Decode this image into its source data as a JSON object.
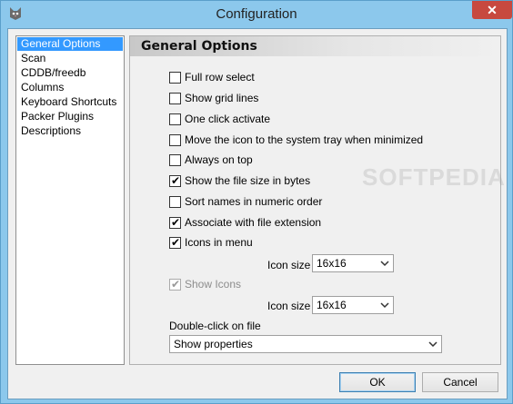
{
  "window": {
    "title": "Configuration",
    "close_glyph": "✕"
  },
  "nav": {
    "items": [
      {
        "label": "General Options",
        "selected": true
      },
      {
        "label": "Scan"
      },
      {
        "label": "CDDB/freedb"
      },
      {
        "label": "Columns"
      },
      {
        "label": "Keyboard Shortcuts"
      },
      {
        "label": "Packer Plugins"
      },
      {
        "label": "Descriptions"
      }
    ]
  },
  "panel": {
    "title": "General Options",
    "options": [
      {
        "label": "Full row select",
        "checked": false
      },
      {
        "label": "Show grid lines",
        "checked": false
      },
      {
        "label": "One click activate",
        "checked": false
      },
      {
        "label": "Move the icon to the system tray when minimized",
        "checked": false
      },
      {
        "label": "Always on top",
        "checked": false
      },
      {
        "label": "Show the file size in bytes",
        "checked": true
      },
      {
        "label": "Sort names in numeric order",
        "checked": false
      },
      {
        "label": "Associate with file extension",
        "checked": true
      },
      {
        "label": "Icons in menu",
        "checked": true
      }
    ],
    "icon_size_1": {
      "label": "Icon size",
      "value": "16x16"
    },
    "show_icons": {
      "label": "Show Icons",
      "checked": true,
      "disabled": true
    },
    "icon_size_2": {
      "label": "Icon size",
      "value": "16x16"
    },
    "double_click": {
      "label": "Double-click on file",
      "value": "Show properties"
    }
  },
  "footer": {
    "ok_label": "OK",
    "cancel_label": "Cancel"
  },
  "watermark": "SOFTPEDIA",
  "colors": {
    "selection": "#3399ff",
    "close": "#c7493f"
  }
}
